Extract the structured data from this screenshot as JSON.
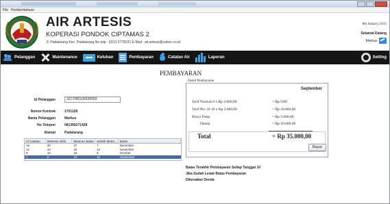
{
  "menubar": {
    "items": [
      "File",
      "Pemberitahuan"
    ]
  },
  "header": {
    "title": "AIR ARTESIS",
    "subtitle": "KOPERASI PONDOK CIPTAMAS 2",
    "address": "Jl. Padalarang Kec. Padalarang No.telp : (022) 5778221 E-Mail : air.artesis@yahoo.co.id",
    "date": "8th January, 2015",
    "welcome": "Selamat Datang",
    "user": "Markus"
  },
  "nav": [
    {
      "label": "Pelanggan",
      "icon": "people-icon"
    },
    {
      "label": "Maintenance",
      "icon": "tools-icon"
    },
    {
      "label": "Keluhan",
      "icon": "complaint-icon"
    },
    {
      "label": "Pembayaran",
      "icon": "payment-icon"
    },
    {
      "label": "Catatan Air",
      "icon": "water-drop-icon"
    },
    {
      "label": "Laporan",
      "icon": "report-chart-icon"
    },
    {
      "label": "Setting",
      "icon": "gear-icon"
    }
  ],
  "page_title": "PEMBAYARAN",
  "customer": {
    "id_label": "Id Pelanggan",
    "id_value": "3217080105930003",
    "contract_label": "Nomor Kontrak",
    "contract_value": "1701128",
    "name_label": "Nama Pelanggan",
    "name_value": "Markus",
    "phone_label": "No Telepon",
    "phone_value": "081395271428",
    "address_label": "Alamat",
    "address_value": "Padalarang"
  },
  "table": {
    "columns": [
      "Id Catatan",
      "Meteran Akhir",
      "Meteran Batas",
      "Selisih Meter...",
      "Bulan"
    ],
    "rows": [
      [
        "16",
        "30",
        "37",
        "7",
        "December"
      ],
      [
        "11",
        "18",
        "30",
        "12",
        "November"
      ],
      [
        "8",
        "10",
        "18",
        "8",
        "October"
      ],
      [
        "7",
        "0",
        "10",
        "10",
        "September"
      ]
    ],
    "selected_index": 3
  },
  "detail": {
    "legend": "Detail Pembayaran",
    "month": "September",
    "rows": [
      {
        "label": "Tarif Normal   0   x   Rp 2.800,00",
        "value": "=   Rp 0,00"
      },
      {
        "label": "Tarif Pro 10   10   x   Rp 2.000,00",
        "value": "=   Rp 20.000,00"
      },
      {
        "label": "Biaya Tetap",
        "value": "=   Rp 5.000,00"
      },
      {
        "label": "Denda",
        "value": "=   Rp 10.000,00"
      }
    ],
    "total_label": "Total",
    "total_value": "=   Rp 35.000,00",
    "pay_button": "Bayar"
  },
  "notes": [
    "Batas Terakhir Pembayaran Setiap Tanggal 10",
    "Jika Sudah Lewat Batas Pembayaran",
    "Dikenakan Denda"
  ],
  "colors": {
    "navbar": "#151515",
    "accent_blue": "#3a9fe8",
    "selected_row": "#3e6da8"
  }
}
